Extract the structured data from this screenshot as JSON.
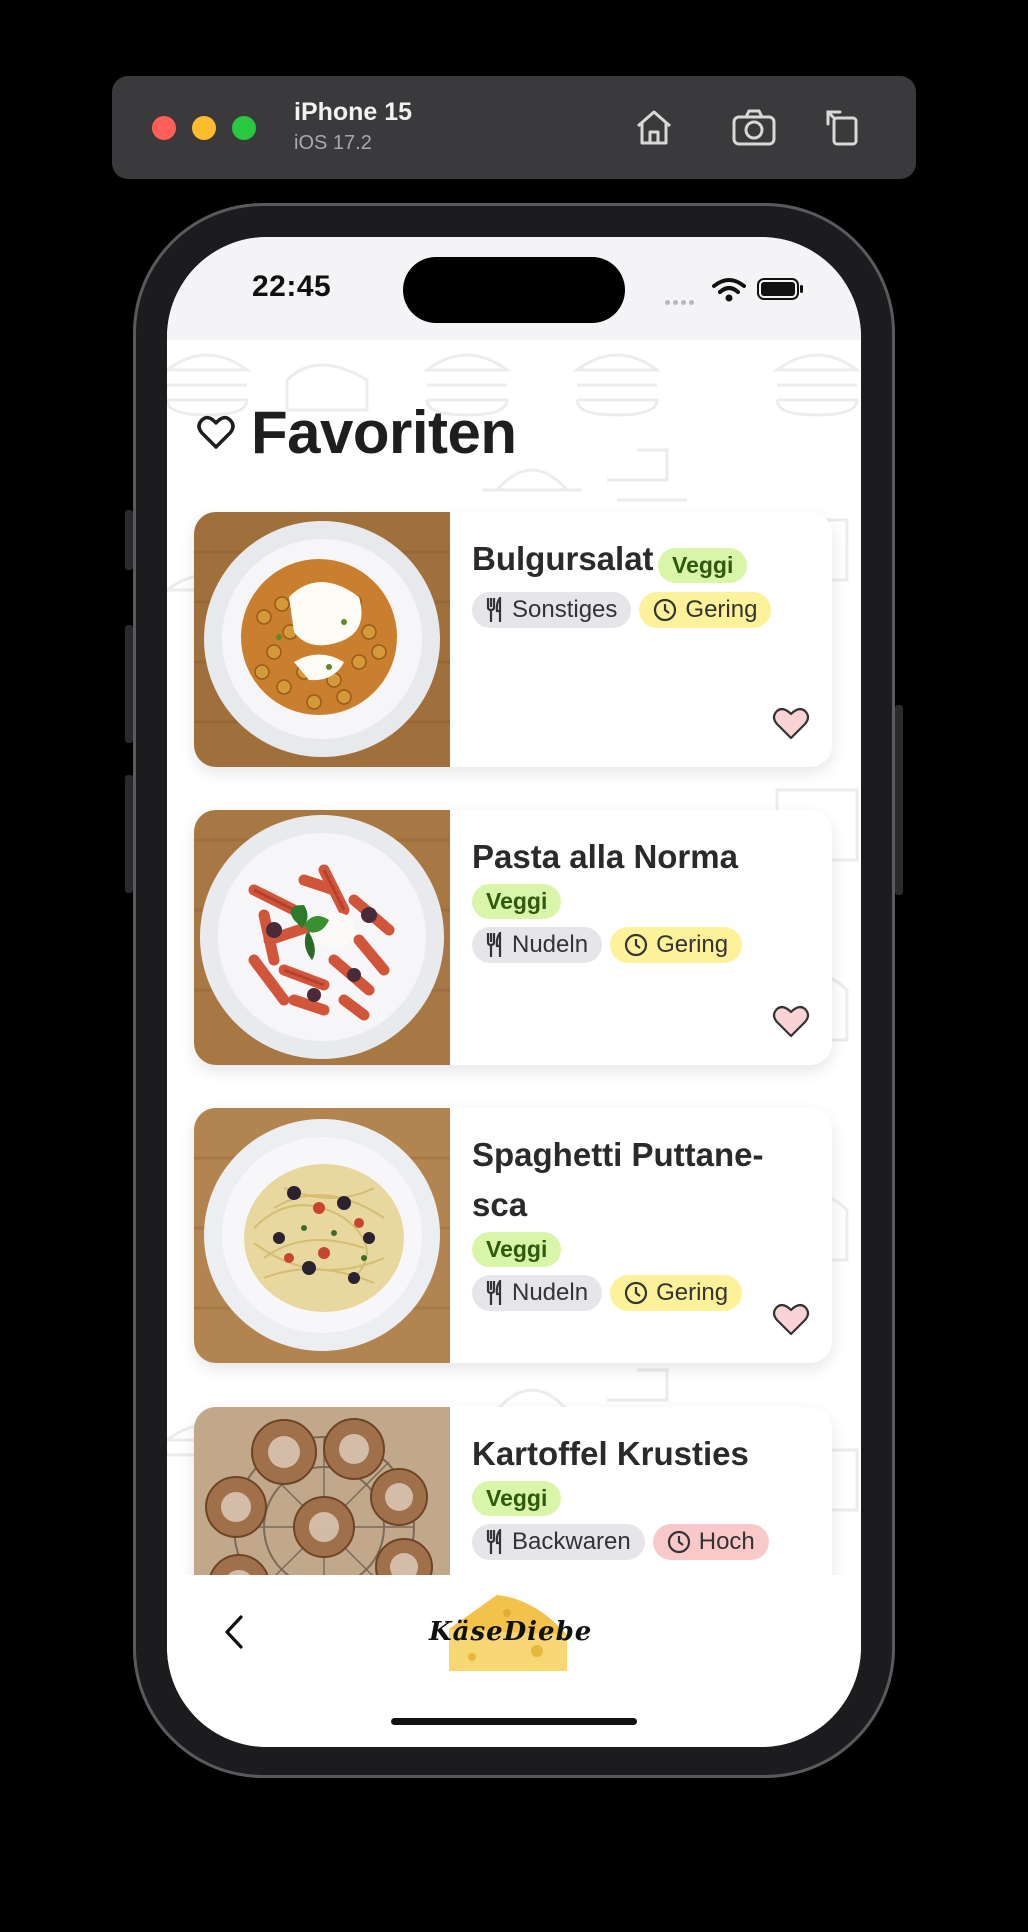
{
  "simulator": {
    "device_name": "iPhone 15",
    "os_version": "iOS 17.2",
    "buttons": [
      "home-icon",
      "screenshot-icon",
      "rotate-icon"
    ]
  },
  "status_bar": {
    "time": "22:45"
  },
  "page": {
    "title": "Favoriten",
    "title_icon": "heart-outline-icon"
  },
  "recipes": [
    {
      "name": "Bulgursalat",
      "badge": "Veggi",
      "category": "Sonstiges",
      "effort": "Gering",
      "effort_level": "low",
      "favorite": true,
      "image": "bulgur-salad-photo"
    },
    {
      "name": "Pasta alla Norma",
      "badge": "Veggi",
      "category": "Nudeln",
      "effort": "Gering",
      "effort_level": "low",
      "favorite": true,
      "image": "penne-photo"
    },
    {
      "name": "Spaghetti Puttane-",
      "name_line2": "sca",
      "badge": "Veggi",
      "category": "Nudeln",
      "effort": "Gering",
      "effort_level": "low",
      "favorite": true,
      "image": "spaghetti-photo"
    },
    {
      "name": "Kartoffel Krusties",
      "badge": "Veggi",
      "category": "Backwaren",
      "effort": "Hoch",
      "effort_level": "high",
      "favorite": true,
      "image": "bread-rolls-photo"
    }
  ],
  "footer": {
    "logo_text": "KäseDiebe"
  },
  "colors": {
    "veggi_bg": "#d9f5a8",
    "effort_low_bg": "#fdf19a",
    "effort_high_bg": "#f9c9ca",
    "category_bg": "#e6e6ea",
    "heart_fill": "#f9d3d5"
  }
}
